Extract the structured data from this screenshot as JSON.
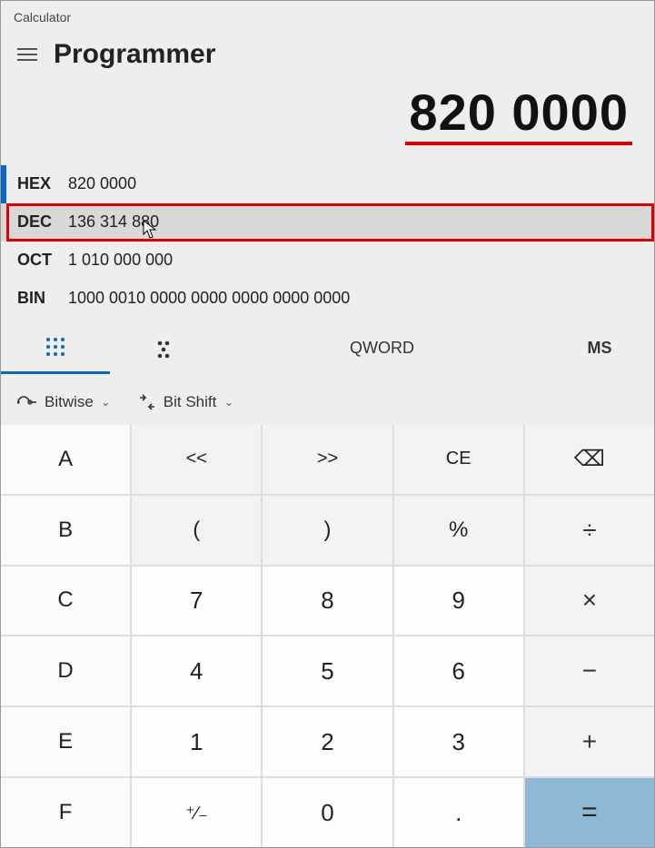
{
  "window": {
    "title": "Calculator"
  },
  "header": {
    "mode": "Programmer"
  },
  "display": {
    "value": "820 0000"
  },
  "bases": {
    "hex": {
      "label": "HEX",
      "value": "820 0000"
    },
    "dec": {
      "label": "DEC",
      "value": "136 314 880"
    },
    "oct": {
      "label": "OCT",
      "value": "1 010 000 000"
    },
    "bin": {
      "label": "BIN",
      "value": "1000 0010 0000 0000 0000 0000 0000"
    }
  },
  "toolbar": {
    "qword": "QWORD",
    "ms": "MS"
  },
  "subtoolbar": {
    "bitwise": "Bitwise",
    "bitshift": "Bit Shift"
  },
  "keys": {
    "A": "A",
    "B": "B",
    "C": "C",
    "D": "D",
    "E": "E",
    "F": "F",
    "lsh": "<<",
    "rsh": ">>",
    "CE": "CE",
    "bksp": "⌫",
    "lp": "(",
    "rp": ")",
    "pct": "%",
    "div": "÷",
    "7": "7",
    "8": "8",
    "9": "9",
    "mul": "×",
    "4": "4",
    "5": "5",
    "6": "6",
    "sub": "−",
    "1": "1",
    "2": "2",
    "3": "3",
    "add": "+",
    "neg": "⁺∕₋",
    "0": "0",
    "dot": ".",
    "eq": "="
  }
}
